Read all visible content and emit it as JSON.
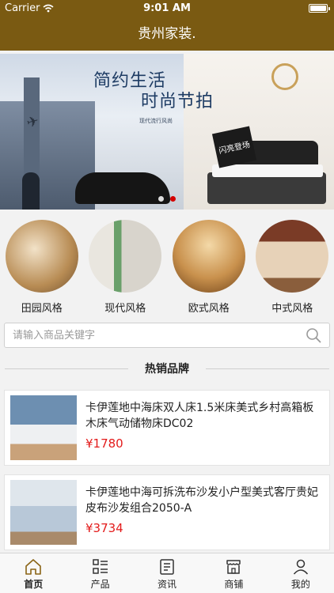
{
  "status_bar": {
    "carrier": "Carrier",
    "time": "9:01 AM"
  },
  "nav": {
    "title": "贵州家装."
  },
  "banner": {
    "headline_1": "简约生活",
    "headline_2": "时尚节拍",
    "badge": "闪亮登场",
    "fine_print": "现代流行风尚",
    "slide_count": 2,
    "active_slide": 2
  },
  "categories": [
    {
      "label": "田园风格"
    },
    {
      "label": "现代风格"
    },
    {
      "label": "欧式风格"
    },
    {
      "label": "中式风格"
    }
  ],
  "search": {
    "placeholder": "请输入商品关键字",
    "value": ""
  },
  "section": {
    "title": "热销品牌"
  },
  "products": [
    {
      "title": "卡伊莲地中海床双人床1.5米床美式乡村高箱板木床气动储物床DC02",
      "price": "¥1780"
    },
    {
      "title": "卡伊莲地中海可拆洗布沙发小户型美式客厅贵妃皮布沙发组合2050-A",
      "price": "¥3734"
    }
  ],
  "tabbar": [
    {
      "label": "首页",
      "icon": "home-icon",
      "active": true
    },
    {
      "label": "产品",
      "icon": "grid-list-icon",
      "active": false
    },
    {
      "label": "资讯",
      "icon": "news-icon",
      "active": false
    },
    {
      "label": "商铺",
      "icon": "store-icon",
      "active": false
    },
    {
      "label": "我的",
      "icon": "user-icon",
      "active": false
    }
  ],
  "colors": {
    "nav_bg": "#7a5a12",
    "price": "#e31b1b",
    "active_dot": "#d40000"
  }
}
